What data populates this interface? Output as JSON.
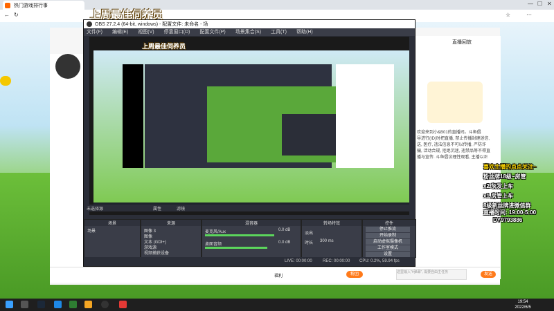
{
  "browser": {
    "tab_title": "热门游戏排行事"
  },
  "obs": {
    "title": "OBS 27.2.4 (64-bit, windows) - 配置文件: 未命名 - 场",
    "menu": [
      "文件(F)",
      "编辑(E)",
      "视图(V)",
      "停靠窗口(D)",
      "配置文件(P)",
      "场景集合(S)",
      "工具(T)",
      "帮助(H)"
    ],
    "preview_label": "未选择源",
    "props_button": "属性",
    "filter_button": "滤镜",
    "docks": {
      "scenes": {
        "title": "场景",
        "items": [
          "场景"
        ]
      },
      "sources": {
        "title": "来源",
        "items": [
          "图像 3",
          "图像",
          "文本 (GDI+)",
          "游戏源",
          "视频捕获设备"
        ]
      },
      "mixer": {
        "title": "混音器",
        "ch1": "麦克风/Aux",
        "ch1_db": "0.0 dB",
        "ch2": "桌面音频",
        "ch2_db": "0.0 dB"
      },
      "transitions": {
        "title": "转场特效",
        "fade": "淡出",
        "duration_label": "时长",
        "duration_value": "300 ms"
      },
      "controls": {
        "title": "控件",
        "buttons": [
          "停止推流",
          "开始录制",
          "启动虚拟摄像机",
          "工作室模式",
          "设置",
          "退出"
        ]
      }
    },
    "status": {
      "live": "LIVE: 00:00:00",
      "rec": "REC: 00:00:00",
      "cpu": "CPU: 0.2%, 59.94 fps"
    }
  },
  "banners": {
    "main": "上周最佳伺养员",
    "mini": "上周最佳伺养员"
  },
  "right_panel": {
    "tabs": [
      "直播回放"
    ],
    "welcome": "欢迎来到小&B01的直播间。斗鱼倡议绿色直播, 理性看待互动, 谨防受骗。",
    "chat": [
      "欢迎来到小&B01的直播间。斗鱼倡",
      "导进行(ID)时把直播, 禁止传播封建迷信,",
      "送, 医疗, 违法信息不可以传播, 严防诈",
      "骗, 活动合规, 拒绝沉迷, 违禁品等不得直",
      "播与宣传. 斗鱼倡议理性观看, 主播以正",
      "当方式赚取收益, 注意理性消费, 警惕",
      "线上线下交友诈骗, 未成年禁止消费."
    ],
    "input_placeholder": "这里输入\"#弹幕\", 需要自由主任务"
  },
  "overlay": {
    "lines": [
      "喜欢主播的点点关注~",
      "粉丝牌18级~房管",
      "x2 灰发上车",
      "x1 房管上车",
      "8级新丝牌进微信群",
      "直播时间: 19:00-5:00",
      "DY9793886"
    ]
  },
  "bottom_bar": {
    "fans": "福利",
    "gift_btn": "粉团",
    "send_btn": "发送"
  },
  "taskbar": {
    "time": "19:54",
    "date": "2022/6/5"
  },
  "colors": {
    "brand": "#ff6f1a",
    "obs_bg": "#2b2e38",
    "meter_green": "#5cd65c",
    "meter_red": "#e04040"
  }
}
